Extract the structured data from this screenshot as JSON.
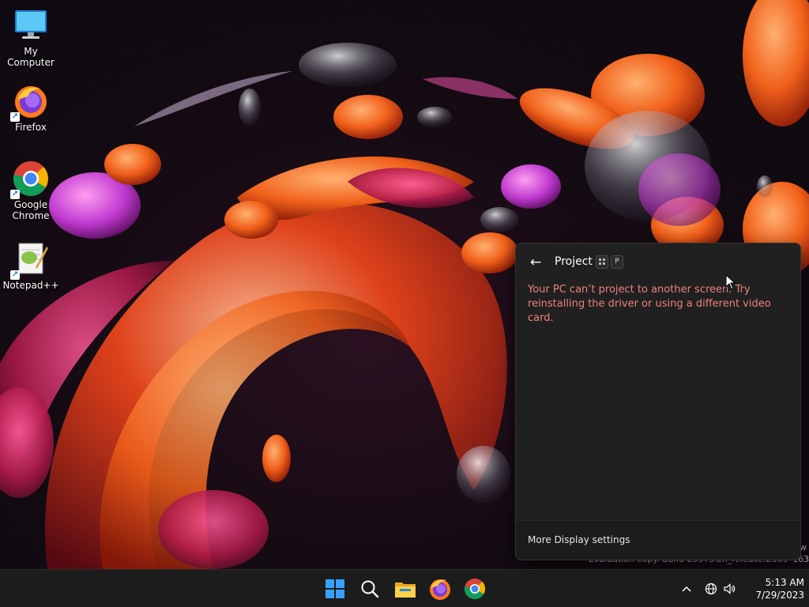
{
  "desktop": {
    "icons": [
      {
        "label": "My Computer",
        "icon": "monitor-icon"
      },
      {
        "label": "Firefox",
        "icon": "firefox-icon"
      },
      {
        "label": "Google Chrome",
        "icon": "chrome-icon"
      },
      {
        "label": "Notepad++",
        "icon": "notepadpp-icon"
      }
    ]
  },
  "project_flyout": {
    "title": "Project",
    "shortcut_keys": [
      "Win",
      "P"
    ],
    "error_message": "Your PC can’t project to another screen. Try reinstalling the driver or using a different video card.",
    "footer_link": "More Display settings"
  },
  "watermark": {
    "line1": "Evaluation copy. Build 25975.zn_release.2309–1632",
    "edge_fragment": "w"
  },
  "taskbar": {
    "pinned": [
      "start-icon",
      "search-icon",
      "file-explorer-icon",
      "firefox-icon",
      "chrome-icon"
    ],
    "tray": {
      "chevron": "^",
      "icons": [
        "network-icon",
        "volume-icon"
      ]
    },
    "clock": {
      "time": "5:13 AM",
      "date": "7/29/2023"
    }
  },
  "colors": {
    "flyout_bg": "#202020",
    "error_text": "#f08080",
    "taskbar_bg": "#1c1c1c"
  }
}
